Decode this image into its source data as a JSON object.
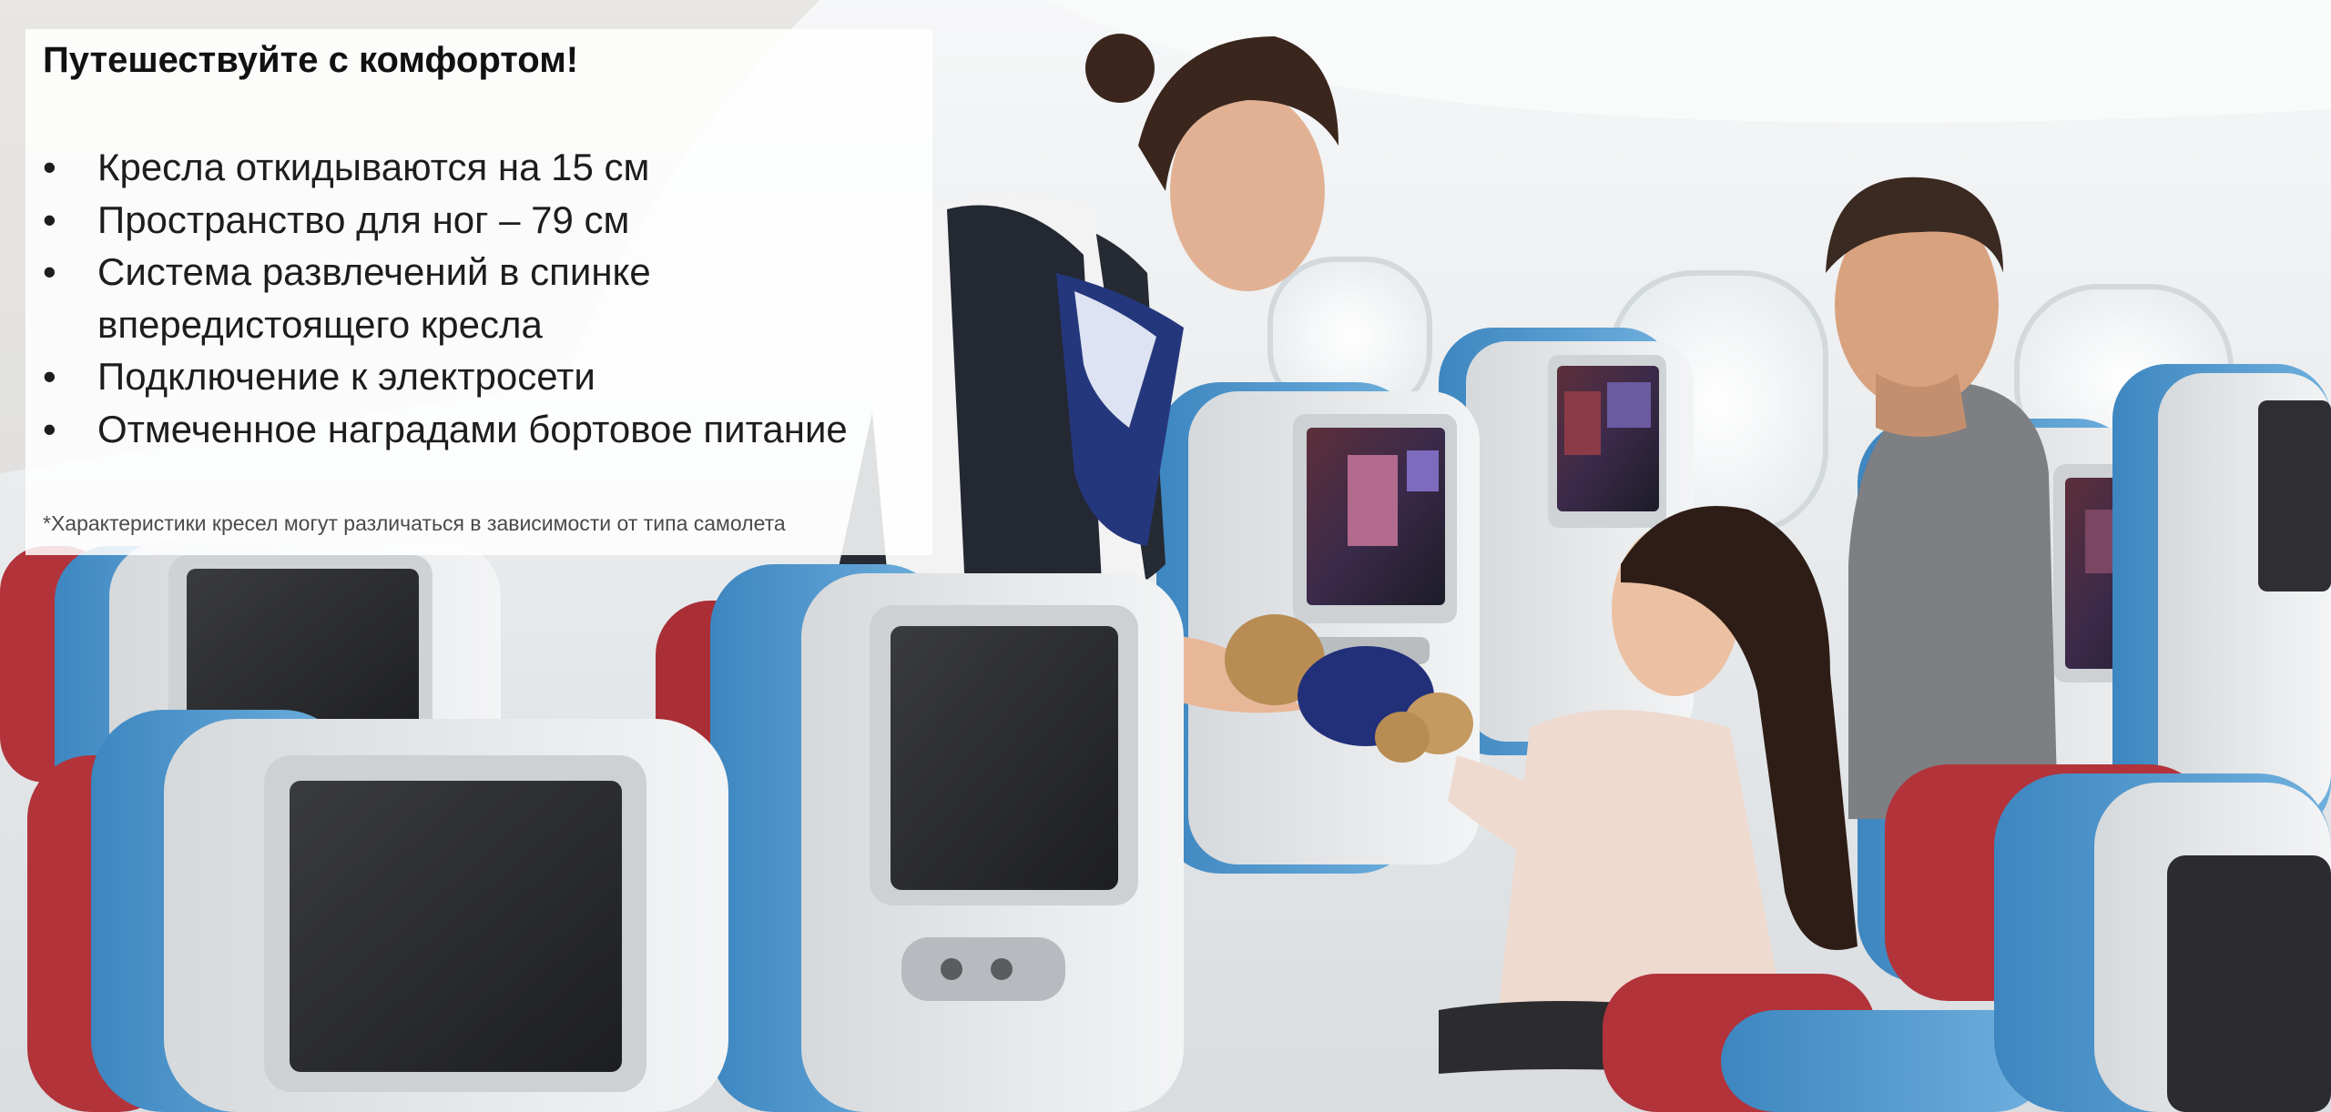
{
  "slide": {
    "title": "Путешествуйте с комфортом!",
    "bullets": [
      "Кресла откидываются на 15 см",
      "Пространство для ног – 79 см",
      "Система развлечений в спинке впередистоящего кресла",
      "Подключение к электросети",
      "Отмеченное наградами бортовое питание"
    ],
    "note": "*Характеристики кресел могут различаться в зависимости от типа самолета",
    "bullet_glyph": "•"
  },
  "colors": {
    "seat_blue": "#4f97cd",
    "seat_red": "#b2333a",
    "shell_white": "#e7e9ec",
    "screen_dark": "#2a2a2c",
    "cabin_wall": "#eef1f3"
  }
}
